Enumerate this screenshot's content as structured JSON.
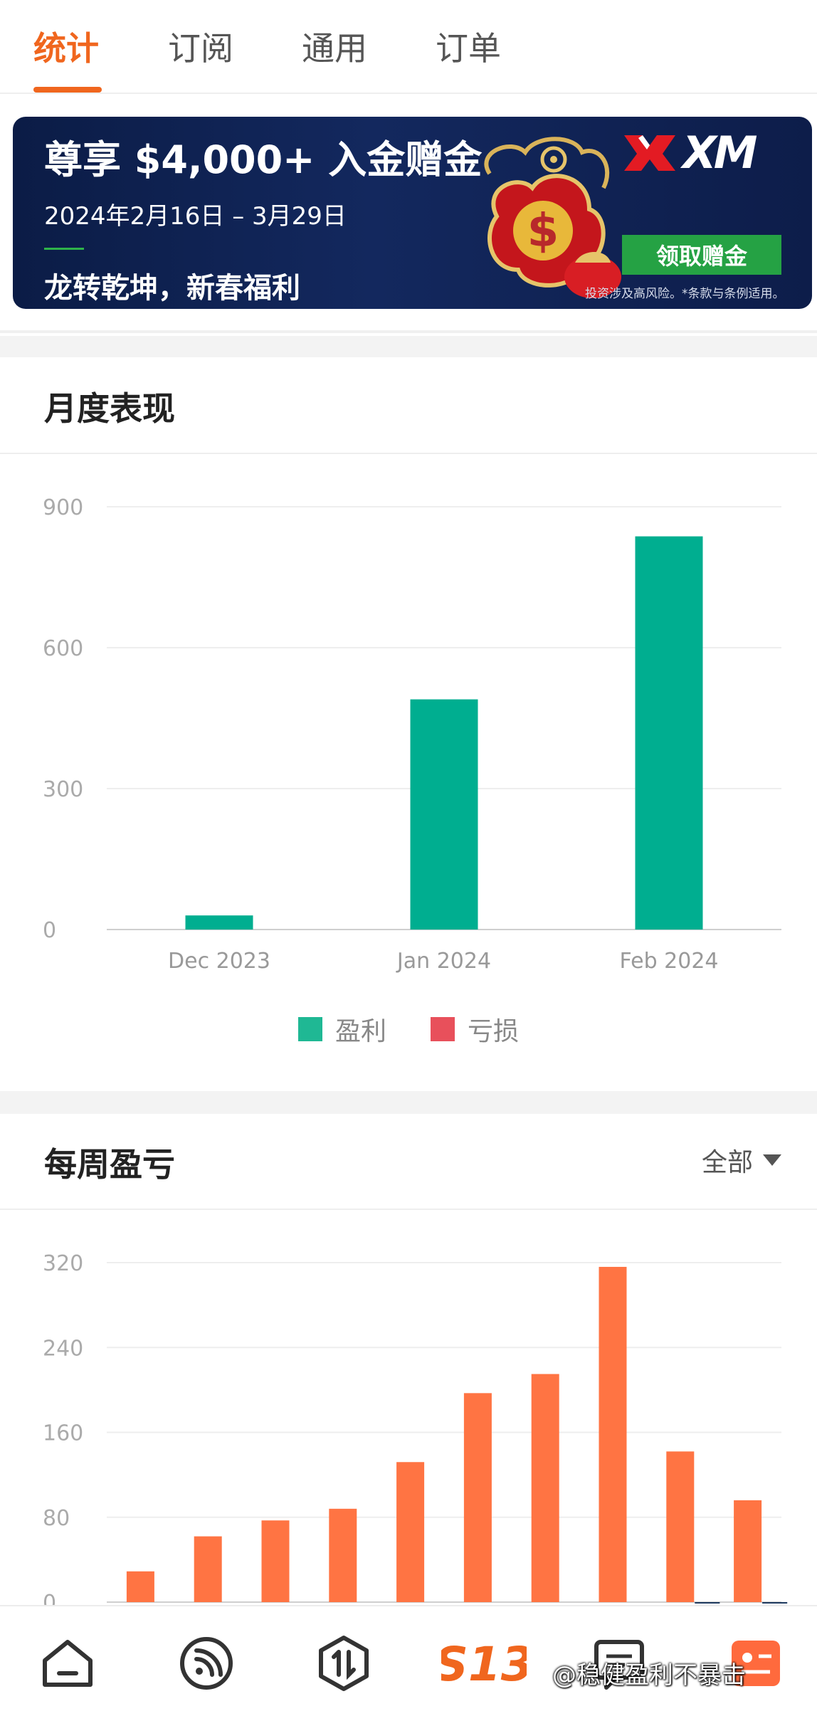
{
  "tabs": [
    {
      "label": "统计",
      "active": true
    },
    {
      "label": "订阅",
      "active": false
    },
    {
      "label": "通用",
      "active": false
    },
    {
      "label": "订单",
      "active": false
    }
  ],
  "banner": {
    "title": "尊享 $4,000+ 入金赠金",
    "date": "2024年2月16日 – 3月29日",
    "slogan": "龙转乾坤，新春福利",
    "brand": "XM",
    "button": "领取赠金",
    "note": "投资涉及高风险。*条款与条例适用。",
    "accent_color": "#25a244"
  },
  "monthly": {
    "title": "月度表现",
    "legend": [
      {
        "label": "盈利",
        "color": "#1fb894"
      },
      {
        "label": "亏损",
        "color": "#e8505b"
      }
    ]
  },
  "weekly": {
    "title": "每周盈亏",
    "filter": "全部",
    "bar_color": "#ff7443"
  },
  "chart_data": [
    {
      "type": "bar",
      "categories": [
        "Dec 2023",
        "Jan 2024",
        "Feb 2024"
      ],
      "series": [
        {
          "name": "盈利",
          "values": [
            30,
            490,
            837
          ],
          "color": "#00ae90"
        },
        {
          "name": "亏损",
          "values": [
            0,
            0,
            0
          ],
          "color": "#e8505b"
        }
      ],
      "yticks": [
        "0",
        "300",
        "600",
        "900"
      ],
      "ylim": [
        0,
        900
      ],
      "grid": true,
      "legend_position": "bottom"
    },
    {
      "type": "bar",
      "categories": [
        "",
        "",
        "",
        "",
        "",
        "",
        "",
        "",
        "",
        ""
      ],
      "series": [
        {
          "values": [
            29,
            62,
            77,
            88,
            132,
            197,
            215,
            316,
            142,
            96
          ],
          "color": "#ff7443"
        },
        {
          "values": [
            0,
            0,
            0,
            0,
            0,
            0,
            0,
            0,
            -1,
            -1
          ],
          "color": "#1e3a5f"
        }
      ],
      "yticks": [
        "0",
        "80",
        "160",
        "240",
        "320"
      ],
      "ylim": [
        0,
        320
      ],
      "grid": true
    }
  ],
  "bottom_nav": [
    {
      "icon": "home-icon"
    },
    {
      "icon": "feed-icon"
    },
    {
      "icon": "trade-icon"
    },
    {
      "icon": "s13-logo",
      "label": "S13",
      "color": "#f0661e"
    },
    {
      "icon": "message-icon"
    },
    {
      "icon": "profile-icon"
    }
  ],
  "watermark": "@稳健盈利不暴击"
}
